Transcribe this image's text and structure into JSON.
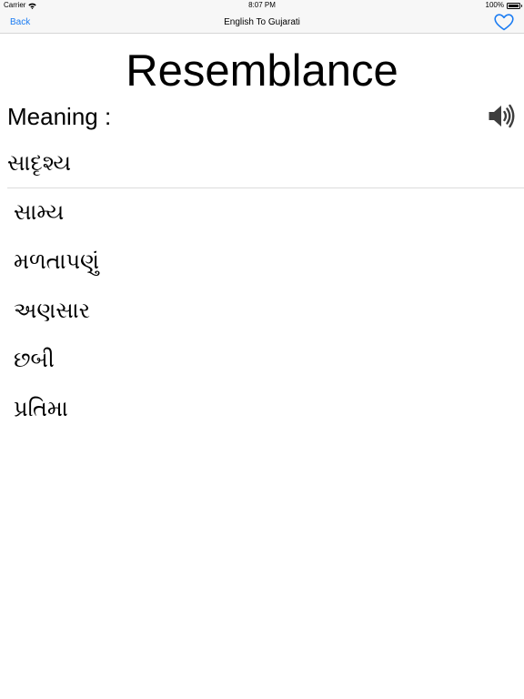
{
  "status_bar": {
    "carrier": "Carrier",
    "wifi_icon": "wifi-icon",
    "time": "8:07 PM",
    "battery": "100%",
    "battery_icon": "battery-icon",
    "battery_level": 1.0
  },
  "nav": {
    "back_label": "Back",
    "title": "English To Gujarati",
    "favorite_icon": "heart-icon",
    "accent_color": "#1b7cf2"
  },
  "word": "Resemblance",
  "meaning_label": "Meaning :",
  "speaker_icon": "speaker-icon",
  "primary_meaning": "સાદૃશ્ય",
  "meanings": [
    "સામ્ય",
    "મળતાપણું",
    "અણસાર",
    "છબી",
    "પ્રતિમા"
  ]
}
